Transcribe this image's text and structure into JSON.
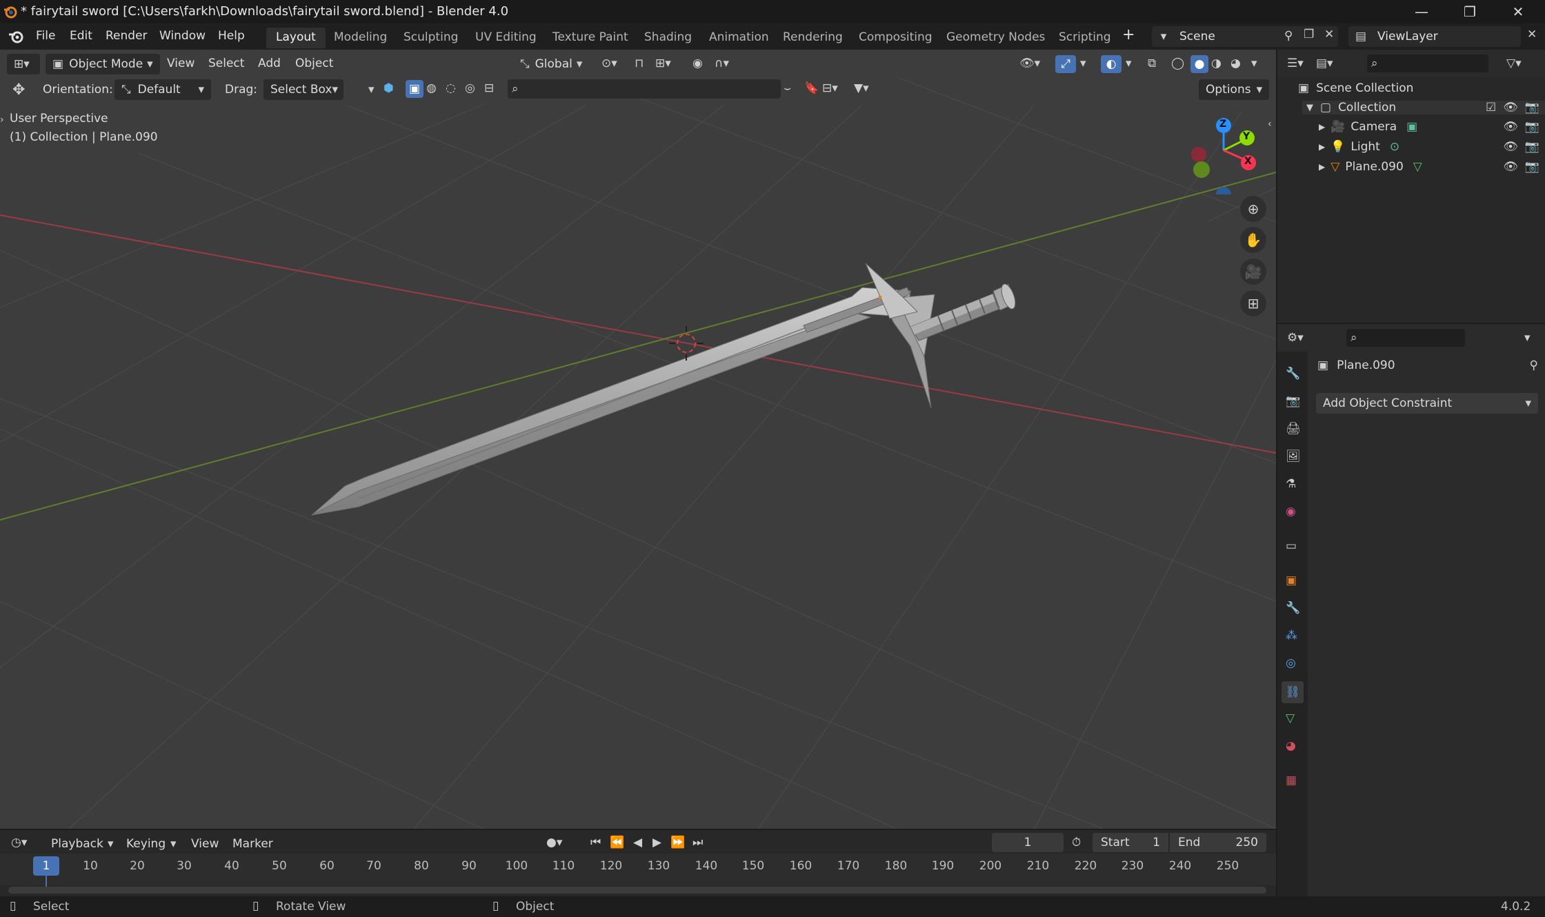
{
  "titlebar": {
    "title": "* fairytail sword [C:\\Users\\farkh\\Downloads\\fairytail sword.blend] - Blender 4.0",
    "minimize": "—",
    "restore": "❐",
    "close": "✕"
  },
  "menu": {
    "items": [
      "File",
      "Edit",
      "Render",
      "Window",
      "Help"
    ],
    "workspaces": [
      "Layout",
      "Modeling",
      "Sculpting",
      "UV Editing",
      "Texture Paint",
      "Shading",
      "Animation",
      "Rendering",
      "Compositing",
      "Geometry Nodes",
      "Scripting"
    ],
    "active_workspace": "Layout",
    "add_workspace": "+",
    "scene": "Scene",
    "view_layer": "ViewLayer"
  },
  "viewport_header": {
    "mode": "Object Mode",
    "menus": [
      "View",
      "Select",
      "Add",
      "Object"
    ],
    "transform_orientation": "Global",
    "orientation_label": "Orientation:",
    "orientation_value": "Default",
    "drag_label": "Drag:",
    "drag_value": "Select Box",
    "options": "Options"
  },
  "viewport": {
    "perspective": "User Perspective",
    "collection_info": "(1) Collection | Plane.090",
    "gizmo": {
      "z": "Z",
      "y": "Y",
      "x": "X"
    }
  },
  "outliner": {
    "root": "Scene Collection",
    "collection": "Collection",
    "items": [
      {
        "label": "Camera",
        "icon": "camera-icon"
      },
      {
        "label": "Light",
        "icon": "light-icon"
      },
      {
        "label": "Plane.090",
        "icon": "mesh-icon"
      }
    ]
  },
  "properties": {
    "object_name": "Plane.090",
    "add_constraint": "Add Object Constraint"
  },
  "timeline": {
    "menus": [
      "Playback",
      "Keying",
      "View",
      "Marker"
    ],
    "current_frame": "1",
    "start_label": "Start",
    "start_value": "1",
    "end_label": "End",
    "end_value": "250",
    "ticks": [
      "1",
      "10",
      "20",
      "30",
      "40",
      "50",
      "60",
      "70",
      "80",
      "90",
      "100",
      "110",
      "120",
      "130",
      "140",
      "150",
      "160",
      "170",
      "180",
      "190",
      "200",
      "210",
      "220",
      "230",
      "240",
      "250"
    ]
  },
  "statusbar": {
    "select": "Select",
    "rotate": "Rotate View",
    "object": "Object",
    "version": "4.0.2"
  },
  "colors": {
    "accent": "#4772b3",
    "axis_x": "#ff3352",
    "axis_y": "#8bdc00",
    "axis_z": "#2890ff",
    "orange": "#e8821e"
  }
}
